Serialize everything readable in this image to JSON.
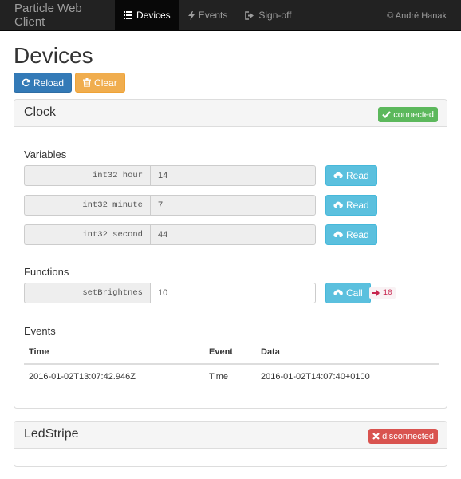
{
  "navbar": {
    "brand": "Particle Web Client",
    "items": [
      {
        "label": "Devices",
        "icon": "list-icon",
        "active": true
      },
      {
        "label": "Events",
        "icon": "bolt-icon",
        "active": false
      },
      {
        "label": "Sign-off",
        "icon": "sign-out-icon",
        "active": false
      }
    ],
    "copyright": "© André Hanak"
  },
  "page": {
    "title": "Devices",
    "reload_label": "Reload",
    "clear_label": "Clear"
  },
  "devices": [
    {
      "name": "Clock",
      "status": "connected",
      "status_color": "#5cb85c",
      "variables_title": "Variables",
      "variables": [
        {
          "signature": "int32 hour",
          "value": "14",
          "button": "Read"
        },
        {
          "signature": "int32 minute",
          "value": "7",
          "button": "Read"
        },
        {
          "signature": "int32 second",
          "value": "44",
          "button": "Read"
        }
      ],
      "functions_title": "Functions",
      "functions": [
        {
          "name": "setBrightnes",
          "value": "10",
          "button": "Call",
          "result": "10"
        }
      ],
      "events_title": "Events",
      "events_table": {
        "columns": [
          "Time",
          "Event",
          "Data"
        ],
        "rows": [
          {
            "time": "2016-01-02T13:07:42.946Z",
            "event": "Time",
            "data": "2016-01-02T14:07:40+0100"
          }
        ]
      }
    },
    {
      "name": "LedStripe",
      "status": "disconnected",
      "status_color": "#d9534f"
    }
  ],
  "colors": {
    "navbar_bg": "#222222",
    "primary": "#337ab7",
    "warning": "#f0ad4e",
    "info": "#5bc0de",
    "success": "#5cb85c",
    "danger": "#d9534f"
  }
}
